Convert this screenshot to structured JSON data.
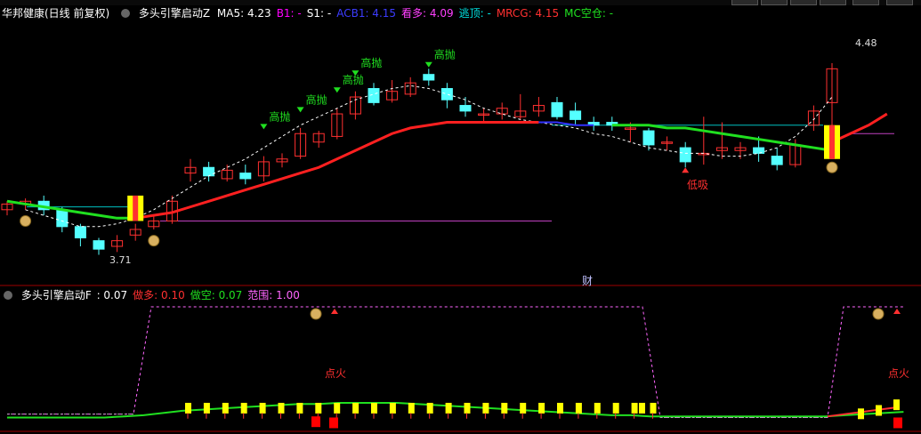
{
  "window": {
    "title": "华邦健康(日线 前复权)"
  },
  "main_header": {
    "indicator_name": "多头引擎启动Z",
    "items": [
      {
        "label": "MA5:",
        "value": "4.23",
        "color": "#ffffff"
      },
      {
        "label": "B1:",
        "value": "-",
        "color": "#ff00ff"
      },
      {
        "label": "S1:",
        "value": "-",
        "color": "#ffffff"
      },
      {
        "label": "ACB1:",
        "value": "4.15",
        "color": "#3c3cff"
      },
      {
        "label": "看多:",
        "value": "4.09",
        "color": "#ff40ff"
      },
      {
        "label": "逃顶:",
        "value": "-",
        "color": "#00e0e0"
      },
      {
        "label": "MRCG:",
        "value": "4.15",
        "color": "#ff3030"
      },
      {
        "label": "MC空仓:",
        "value": "-",
        "color": "#20e020"
      }
    ]
  },
  "sub_header": {
    "indicator_name": "多头引擎启动F",
    "items": [
      {
        "label": ":",
        "value": "0.07",
        "color": "#ffffff"
      },
      {
        "label": "做多:",
        "value": "0.10",
        "color": "#ff3030"
      },
      {
        "label": "做空:",
        "value": "0.07",
        "color": "#20e020"
      },
      {
        "label": "范围:",
        "value": "1.00",
        "color": "#ff66ff"
      }
    ]
  },
  "annotations": {
    "price_high": "4.48",
    "price_low": "3.71",
    "sell_label": "高抛",
    "buy_label": "低吸",
    "finance_marker": "财",
    "ignite_label": "点火"
  },
  "colors": {
    "up": "#ff3030",
    "down": "#54ffff",
    "ma_dashed": "#ffffff",
    "ma_red": "#ff2020",
    "ma_green": "#20e020",
    "ma_blue": "#3030ff",
    "signal_yellow": "#ffff00",
    "level_cyan": "#00c0c0",
    "level_magenta": "#c040c0",
    "range_line": "#ff66ff"
  }
}
